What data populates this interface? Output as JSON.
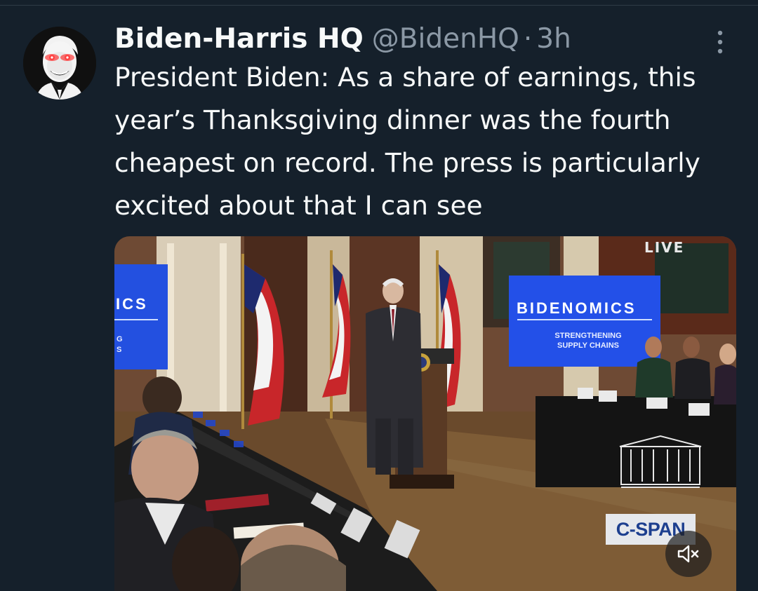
{
  "tweet": {
    "display_name": "Biden-Harris HQ",
    "handle": "@BidenHQ",
    "separator": "·",
    "time": "3h",
    "text": "President Biden: As a share of earnings, this year’s Thanksgiving dinner was the fourth cheapest on record. The press is particularly excited about that I can see",
    "avatar_icon": "laser-eyes-portrait-icon",
    "more_icon": "more-vertical-icon"
  },
  "media": {
    "live_badge": "LIVE",
    "banner_title": "BIDENOMICS",
    "banner_subtitle_line1": "STRENGTHENING",
    "banner_subtitle_line2": "SUPPLY CHAINS",
    "left_banner_title": "ICS",
    "left_banner_sub_line1": "G",
    "left_banner_sub_line2": "S",
    "network_logo": "C-SPAN",
    "mute_icon": "muted-speaker-icon"
  },
  "colors": {
    "background": "#15202b",
    "text_primary": "#f7f9f9",
    "text_secondary": "#8b98a5",
    "banner_blue": "#2246d8"
  }
}
